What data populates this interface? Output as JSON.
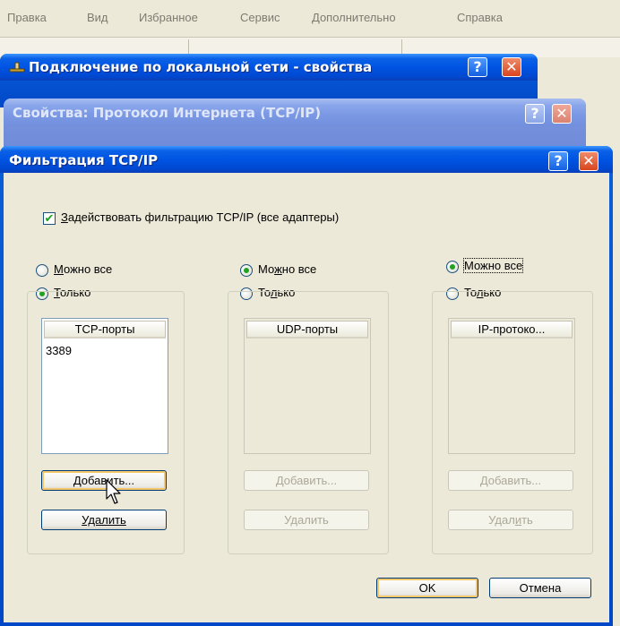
{
  "menubar": {
    "items": [
      "Правка",
      "Вид",
      "Избранное",
      "Сервис",
      "Дополнительно",
      "Справка"
    ]
  },
  "windows": {
    "network": {
      "title": "Подключение по локальной сети - свойства",
      "help": "?",
      "close": "✕"
    },
    "tcpip": {
      "title": "Свойства: Протокол Интернета (TCP/IP)",
      "help": "?",
      "close": "✕"
    },
    "filter": {
      "title": "Фильтрация TCP/IP",
      "help": "?",
      "close": "✕"
    }
  },
  "filter": {
    "enable_prefix": "З",
    "enable_rest": "адействовать фильтрацию TCP/IP (все адаптеры)",
    "enable_checked": true,
    "tcp": {
      "radio_all_a": "М",
      "radio_all_b": "ожно все",
      "radio_only_a": "Т",
      "radio_only_b": "олько",
      "selected": "only",
      "header": "TCP-порты",
      "items": [
        "3389"
      ],
      "add": "Добавить...",
      "remove": "Удалить"
    },
    "udp": {
      "radio_all_a": "Мо",
      "radio_all_b": "ж",
      "radio_all_c": "но все",
      "radio_only_a": "То",
      "radio_only_b": "л",
      "radio_only_c": "ько",
      "selected": "all",
      "header": "UDP-порты",
      "items": [],
      "add": "Добавить...",
      "remove_a": "У",
      "remove_b": "д",
      "remove_c": "алить"
    },
    "ip": {
      "radio_all": "Можно все",
      "radio_only_a": "То",
      "radio_only_b": "л",
      "radio_only_c": "ько",
      "selected": "all",
      "header": "IP-протоко...",
      "items": [],
      "add": "Добавить...",
      "remove_a": "Удал",
      "remove_b": "и",
      "remove_c": "ть"
    },
    "ok": "OK",
    "cancel": "Отмена"
  }
}
